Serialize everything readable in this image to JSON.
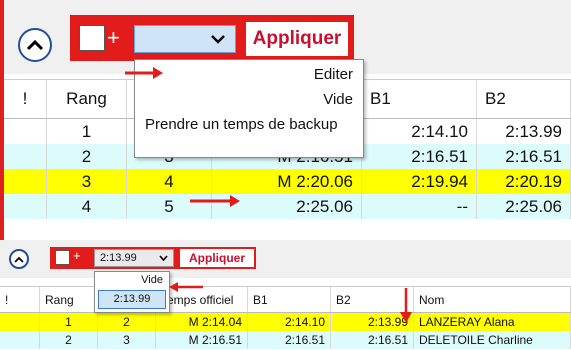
{
  "colors": {
    "red": "#e21b1b",
    "apply_text": "#c8102e",
    "yellow": "#ffff00",
    "light_cyan": "#dcfbfb",
    "combo_blue": "#cfe4f7"
  },
  "top": {
    "apply_label": "Appliquer",
    "checkbox_plus": "+",
    "combo_value": "",
    "menu": [
      "Editer",
      "Vide",
      "Prendre un temps de backup"
    ],
    "columns": [
      "!",
      "Rang",
      "",
      "",
      "B1",
      "B2"
    ],
    "rows": [
      {
        "flag": "",
        "rang": "1",
        "col2": "",
        "temps": "",
        "b1": "2:14.10",
        "b2": "2:13.99",
        "style": "white"
      },
      {
        "flag": "",
        "rang": "2",
        "col2": "3",
        "temps": "M 2:16.51",
        "b1": "2:16.51",
        "b2": "2:16.51",
        "style": "cyan"
      },
      {
        "flag": "",
        "rang": "3",
        "col2": "4",
        "temps": "M 2:20.06",
        "b1": "2:19.94",
        "b2": "2:20.19",
        "style": "yellow"
      },
      {
        "flag": "",
        "rang": "4",
        "col2": "5",
        "temps": "2:25.06",
        "b1": "--",
        "b2": "2:25.06",
        "style": "cyan"
      }
    ]
  },
  "bottom": {
    "apply_label": "Appliquer",
    "checkbox_plus": "+",
    "combo_value": "2:13.99",
    "menu": {
      "vide": "Vide",
      "selected_option": "2:13.99"
    },
    "columns": [
      "!",
      "Rang",
      "",
      "Temps officiel",
      "B1",
      "B2",
      "Nom"
    ],
    "rows": [
      {
        "flag": "",
        "rang": "1",
        "col2": "2",
        "temps": "M 2:14.04",
        "b1": "2:14.10",
        "b2": "2:13.99",
        "nom": "LANZERAY Alana",
        "style": "yellow"
      },
      {
        "flag": "",
        "rang": "2",
        "col2": "3",
        "temps": "M 2:16.51",
        "b1": "2:16.51",
        "b2": "2:16.51",
        "nom": "DELETOILE Charline",
        "style": "cyan"
      }
    ]
  }
}
